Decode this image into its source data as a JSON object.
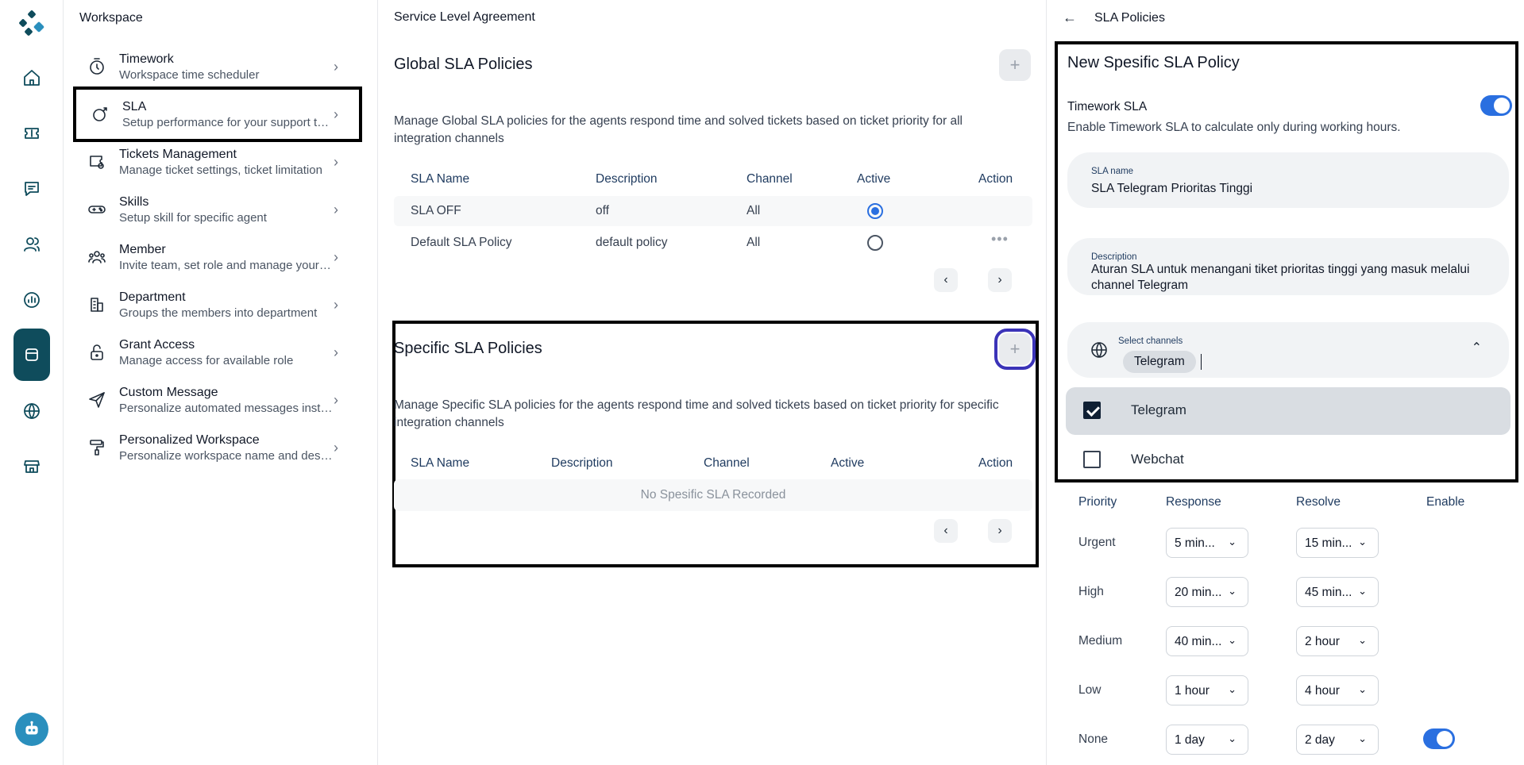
{
  "rail": {
    "icons": [
      "logo-icon",
      "home-icon",
      "ticket-icon",
      "chat-icon",
      "contacts-icon",
      "report-icon",
      "settings-icon",
      "globe-icon",
      "store-icon"
    ]
  },
  "menu": {
    "title": "Workspace",
    "items": [
      {
        "title": "Timework",
        "sub": "Workspace time scheduler",
        "icon": "stopwatch-icon"
      },
      {
        "title": "SLA",
        "sub": "Setup performance for your support team",
        "icon": "target-icon"
      },
      {
        "title": "Tickets Management",
        "sub": "Manage ticket settings, ticket limitation",
        "icon": "ticket-settings-icon"
      },
      {
        "title": "Skills",
        "sub": "Setup skill for specific agent",
        "icon": "gamepad-icon"
      },
      {
        "title": "Member",
        "sub": "Invite team, set role and manage your members",
        "icon": "team-icon"
      },
      {
        "title": "Department",
        "sub": "Groups the members into department",
        "icon": "building-icon"
      },
      {
        "title": "Grant Access",
        "sub": "Manage access for available role",
        "icon": "lock-icon"
      },
      {
        "title": "Custom Message",
        "sub": "Personalize automated messages instantly",
        "icon": "send-icon"
      },
      {
        "title": "Personalized Workspace",
        "sub": "Personalize workspace name and design",
        "icon": "paint-roller-icon"
      }
    ]
  },
  "mid": {
    "breadcrumb": "Service Level Agreement",
    "global": {
      "title": "Global SLA Policies",
      "plus": "+",
      "desc": "Manage Global SLA policies for the agents respond time and solved tickets based on ticket priority for all integration channels",
      "headers": {
        "name": "SLA Name",
        "description": "Description",
        "channel": "Channel",
        "active": "Active",
        "action": "Action"
      },
      "rows": [
        {
          "name": "SLA OFF",
          "description": "off",
          "channel": "All",
          "active": true
        },
        {
          "name": "Default SLA Policy",
          "description": "default policy",
          "channel": "All",
          "active": false,
          "action": "•••"
        }
      ],
      "prev": "‹",
      "next": "›"
    },
    "specific": {
      "title": "Specific SLA Policies",
      "plus": "+",
      "desc": "Manage Specific SLA policies for the agents respond time and solved tickets based on ticket priority for specific integration channels",
      "headers": {
        "name": "SLA Name",
        "description": "Description",
        "channel": "Channel",
        "active": "Active",
        "action": "Action"
      },
      "empty": "No Spesific SLA Recorded",
      "prev": "‹",
      "next": "›"
    }
  },
  "right": {
    "back": "←",
    "title": "SLA Policies",
    "form": {
      "title": "New Spesific SLA Policy",
      "timework_label": "Timework SLA",
      "timework_desc": "Enable Timework SLA to calculate only during working hours.",
      "timework_on": true,
      "name_label": "SLA name",
      "name_value": "SLA Telegram Prioritas Tinggi",
      "desc_label": "Description",
      "desc_value": "Aturan SLA untuk menangani tiket prioritas tinggi yang masuk melalui channel Telegram",
      "channels_label": "Select channels",
      "channels_chip": "Telegram",
      "channels_chevron": "⌃",
      "options": [
        {
          "label": "Telegram",
          "checked": true
        },
        {
          "label": "Webchat",
          "checked": false
        }
      ]
    },
    "priority": {
      "headers": {
        "priority": "Priority",
        "response": "Response",
        "resolve": "Resolve",
        "enable": "Enable"
      },
      "rows": [
        {
          "name": "Urgent",
          "response": "5  min...",
          "resolve": "15  min..."
        },
        {
          "name": "High",
          "response": "20  min...",
          "resolve": "45  min..."
        },
        {
          "name": "Medium",
          "response": "40  min...",
          "resolve": "2  hour"
        },
        {
          "name": "Low",
          "response": "1  hour",
          "resolve": "4  hour"
        },
        {
          "name": "None",
          "response": "1  day",
          "resolve": "2  day",
          "enable": true
        }
      ]
    }
  }
}
